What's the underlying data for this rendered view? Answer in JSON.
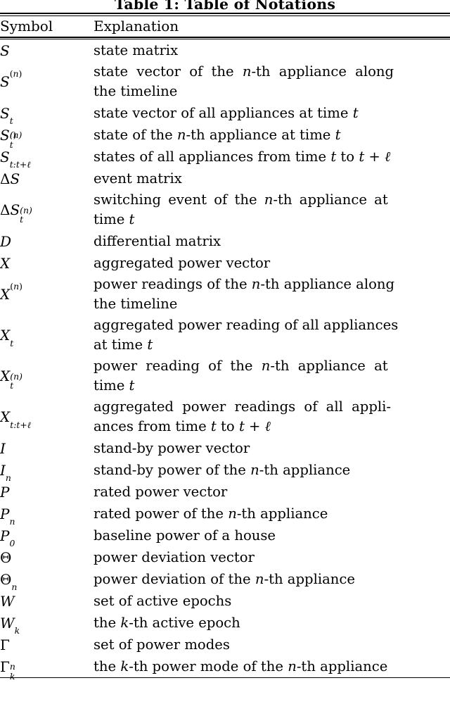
{
  "caption": "Table 1: Table of Notations",
  "header": {
    "symbol": "Symbol",
    "explanation": "Explanation"
  },
  "rows": [
    {
      "symbol": "S",
      "explanation": "state matrix"
    },
    {
      "symbol": "S^(n)",
      "explanation": "state vector of the n-th appliance along the timeline"
    },
    {
      "symbol": "S_t",
      "explanation": "state vector of all appliances at time t"
    },
    {
      "symbol": "S_t^(n)",
      "explanation": "state of the n-th appliance at time t"
    },
    {
      "symbol": "S_{t:t+l}",
      "explanation": "states of all appliances from time t to t + l"
    },
    {
      "symbol": "DeltaS",
      "explanation": "event matrix"
    },
    {
      "symbol": "DeltaS_t^(n)",
      "explanation": "switching event of the n-th appliance at time t"
    },
    {
      "symbol": "D",
      "explanation": "differential matrix"
    },
    {
      "symbol": "X",
      "explanation": "aggregated power vector"
    },
    {
      "symbol": "X^(n)",
      "explanation": "power readings of the n-th appliance along the timeline"
    },
    {
      "symbol": "X_t",
      "explanation": "aggregated power reading of all appliances at time t"
    },
    {
      "symbol": "X_t^(n)",
      "explanation": "power reading of the n-th appliance at time t"
    },
    {
      "symbol": "X_{t:t+l}",
      "explanation": "aggregated power readings of all appliances from time t to t + l"
    },
    {
      "symbol": "I",
      "explanation": "stand-by power vector"
    },
    {
      "symbol": "I_n",
      "explanation": "stand-by power of the n-th appliance"
    },
    {
      "symbol": "P",
      "explanation": "rated power vector"
    },
    {
      "symbol": "P_n",
      "explanation": "rated power of the n-th appliance"
    },
    {
      "symbol": "P_0",
      "explanation": "baseline power of a house"
    },
    {
      "symbol": "Theta",
      "explanation": "power deviation vector"
    },
    {
      "symbol": "Theta_n",
      "explanation": "power deviation of the n-th appliance"
    },
    {
      "symbol": "W",
      "explanation": "set of active epochs"
    },
    {
      "symbol": "W_k",
      "explanation": "the k-th active epoch"
    },
    {
      "symbol": "Gamma",
      "explanation": "set of power modes"
    },
    {
      "symbol": "Gamma^n_k",
      "explanation": "the k-th power mode of the n-th appliance"
    }
  ]
}
